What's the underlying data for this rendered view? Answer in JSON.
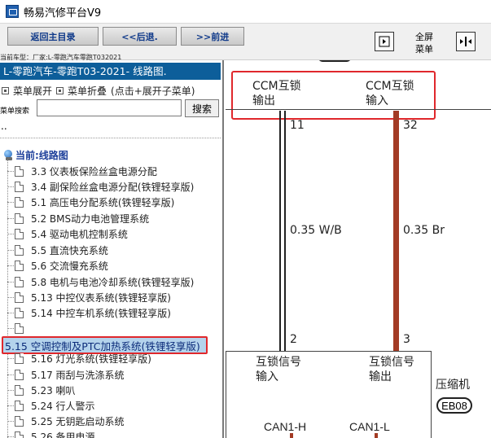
{
  "window": {
    "title": "畅易汽修平台V9"
  },
  "toolbar": {
    "home_label": "返回主目录",
    "back_label": "<<后退.",
    "forward_label": ">>前进",
    "fullscreen_label_1": "全屏",
    "fullscreen_label_2": "菜单",
    "vehicle_type": "当前车型：厂家:L-零跑汽车零跑T032021"
  },
  "sidebar": {
    "vehicle": "L-零跑汽车-零跑T03-2021- 线路图.",
    "expand_label": "菜单展开",
    "collapse_label": "菜单折叠",
    "collapse_hint": "(点击+展开子菜单)",
    "search_label": "菜单搜索",
    "search_value": "",
    "search_button": "搜索",
    "dots": "..",
    "root_label": "当前:线路图",
    "items": [
      {
        "label": "3.3 仪表板保险丝盒电源分配"
      },
      {
        "label": "3.4 副保险丝盒电源分配(铁锂轻享版)"
      },
      {
        "label": "5.1 高压电分配系统(铁锂轻享版)"
      },
      {
        "label": "5.2 BMS动力电池管理系统"
      },
      {
        "label": "5.4 驱动电机控制系统"
      },
      {
        "label": "5.5 直流快充系统"
      },
      {
        "label": "5.6 交流慢充系统"
      },
      {
        "label": "5.8 电机与电池冷却系统(铁锂轻享版)"
      },
      {
        "label": "5.13 中控仪表系统(铁锂轻享版)"
      },
      {
        "label": "5.14 中控车机系统(铁锂轻享版)"
      },
      {
        "label": ""
      }
    ],
    "selected_item": "5.15 空调控制及PTC加热系统(铁锂轻享版)",
    "items_after": [
      {
        "label": "5.16 灯光系统(铁锂轻享版)"
      },
      {
        "label": "5.17 雨刮与洗涤系统"
      },
      {
        "label": "5.23 喇叭"
      },
      {
        "label": "5.24 行人警示"
      },
      {
        "label": "5.25 无钥匙启动系统"
      },
      {
        "label": "5.26 备用电源"
      }
    ]
  },
  "diagram": {
    "ccm_out_1": "CCM互锁",
    "ccm_out_2": "输出",
    "ccm_in_1": "CCM互锁",
    "ccm_in_2": "输入",
    "pin_left_top": "11",
    "pin_right_top": "32",
    "wire_left": "0.35 W/B",
    "wire_right": "0.35 Br",
    "pin_left_bottom": "2",
    "pin_right_bottom": "3",
    "sig_in_1": "互锁信号",
    "sig_in_2": "输入",
    "sig_out_1": "互锁信号",
    "sig_out_2": "输出",
    "component_name": "压缩机",
    "connector_id": "EB08",
    "can1h": "CAN1-H",
    "can1l": "CAN1-L",
    "wire_colors": {
      "white_black": "#222222",
      "brown": "#a33b24"
    },
    "highlight_color": "#e0282c"
  }
}
